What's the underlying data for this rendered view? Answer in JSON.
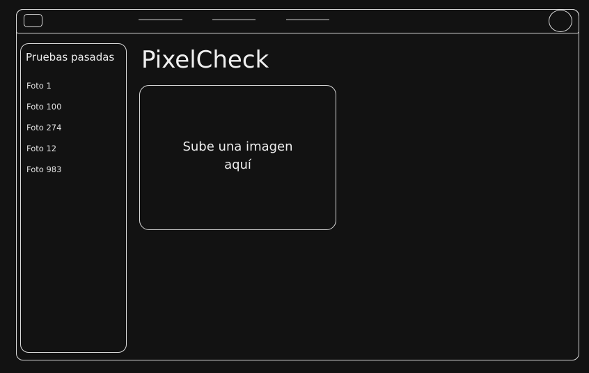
{
  "header": {
    "menu_icon": "hamburger-menu-icon",
    "nav_items": [
      "",
      "",
      ""
    ],
    "avatar_icon": "user-avatar-icon"
  },
  "sidebar": {
    "title": "Pruebas pasadas",
    "items": [
      {
        "label": "Foto 1"
      },
      {
        "label": "Foto 100"
      },
      {
        "label": "Foto 274"
      },
      {
        "label": "Foto 12"
      },
      {
        "label": "Foto 983"
      }
    ]
  },
  "main": {
    "title": "PixelCheck",
    "upload_text": "Sube una imagen\naquí"
  },
  "colors": {
    "background": "#121212",
    "stroke": "#d9d9d9",
    "text": "#ececec"
  }
}
